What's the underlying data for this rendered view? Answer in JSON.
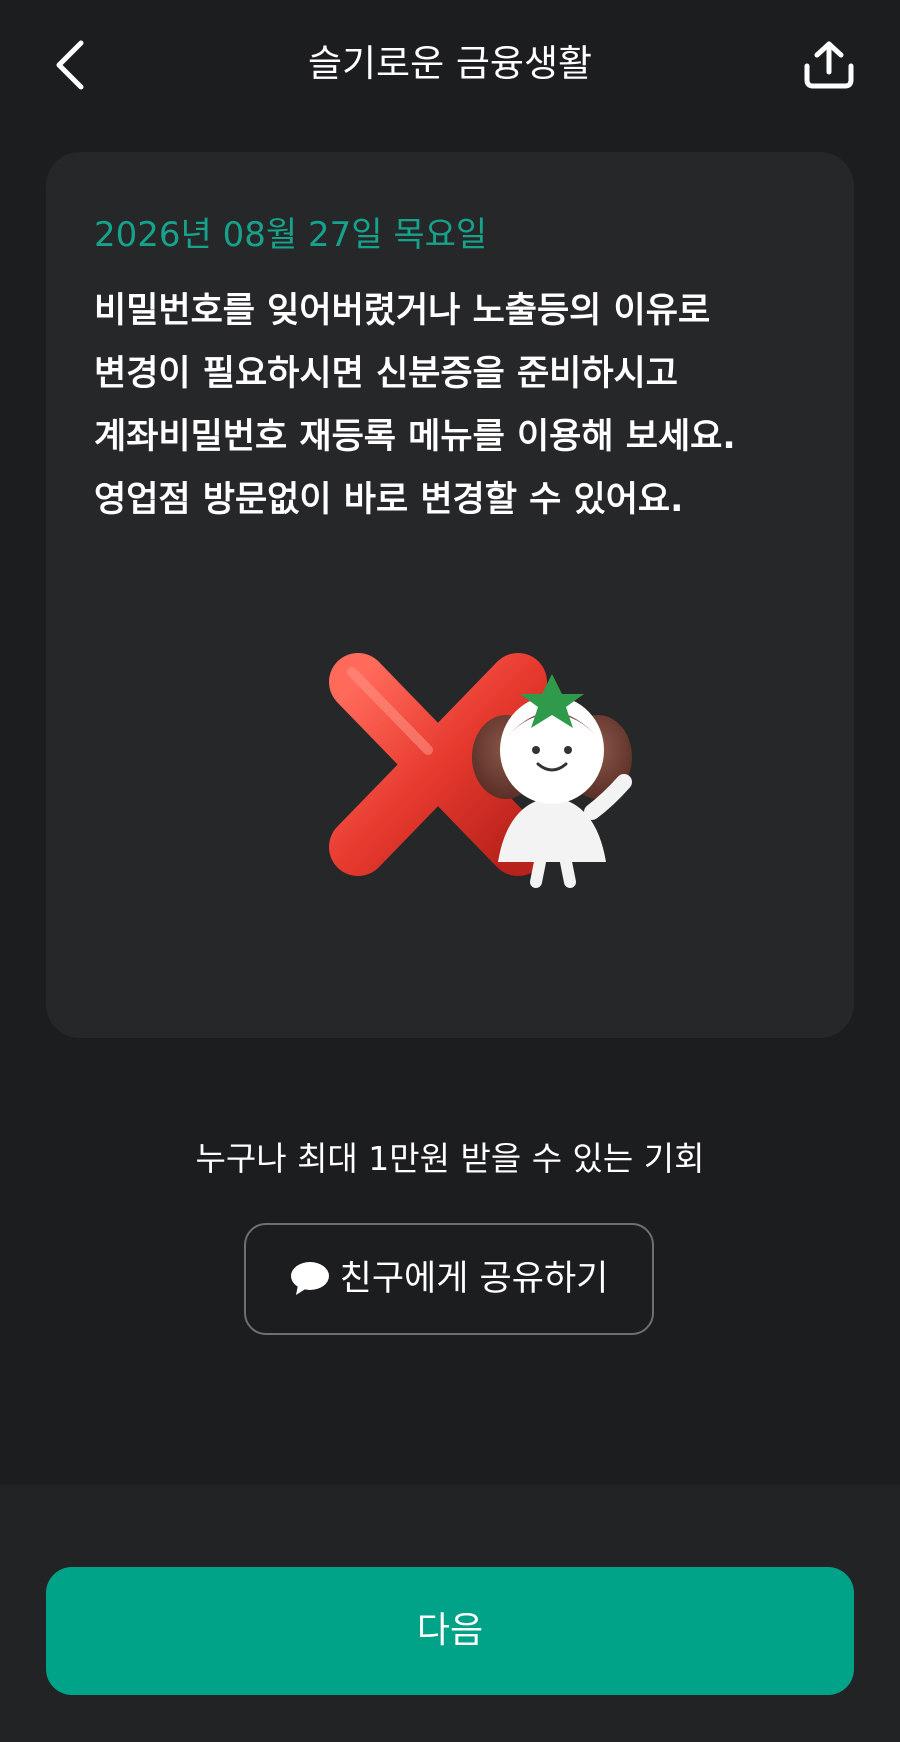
{
  "header": {
    "title": "슬기로운 금융생활",
    "back_icon": "chevron-left-icon",
    "share_icon": "share-upload-icon"
  },
  "card": {
    "date": "2026년 08월 27일 목요일",
    "lines": [
      "비밀번호를 잊어버렸거나 노출등의 이유로",
      "변경이 필요하시면 신분증을 준비하시고",
      "계좌비밀번호 재등록 메뉴를 이용해 보세요.",
      "영업점 방문없이 바로 변경할 수 있어요."
    ],
    "illustration": "red-x-with-mascot"
  },
  "promo": {
    "text": "누구나 최대 1만원 받을 수 있는 기회"
  },
  "share_button": {
    "label": "친구에게 공유하기",
    "icon": "chat-bubble-icon"
  },
  "footer": {
    "next_label": "다음"
  },
  "colors": {
    "background": "#1c1d1f",
    "card": "#262729",
    "accent": "#00a387",
    "date": "#16a28b",
    "x_mark": "#e63b30"
  }
}
